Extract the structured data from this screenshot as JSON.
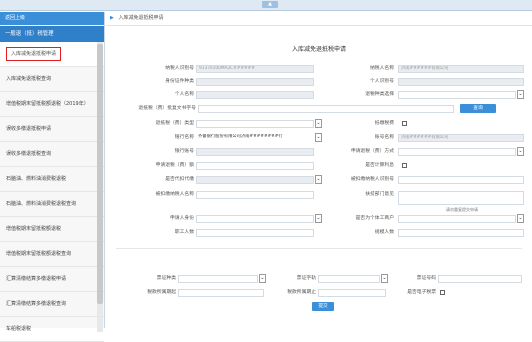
{
  "topbar": {
    "tab_glyph": "▲"
  },
  "sidebar": {
    "header": "返回上级",
    "group": "一般退（抵）税管理",
    "items": [
      "入库减免退抵税申请",
      "入库减免退抵税查询",
      "增值税期末留抵税额退税（2019年）",
      "误收多缴退抵税申请",
      "误收多缴退抵税查询",
      "石脑油、燃料油消费税退税",
      "石脑油、燃料油消费税退税查询",
      "增值税期末留抵税额退税",
      "增值税期末留抵税额退税查询",
      "汇算清缴结算多缴退税申请",
      "汇算清缴结算多缴退税查询",
      "车船税退税"
    ]
  },
  "breadcrumb": {
    "home_icon": "▶",
    "text": "入库减免退抵税申请"
  },
  "form": {
    "title": "入库减免退抵税申请",
    "taxpayer_id_label": "纳税人识别号",
    "taxpayer_id_value": "91370100MA3C######",
    "taxpayer_name_label": "纳税人名称",
    "taxpayer_name_value": "济南######有限公司",
    "idtype_label": "身份证件种类",
    "person_id_label": "个人识别号",
    "person_name_label": "个人名称",
    "refund_type_label": "退税种类选择",
    "refund_type_value": "",
    "doc_no_label": "退抵税（费）批复文书字号",
    "query_button": "查询",
    "apply_type_label": "退抵税（费）类型",
    "offset_label": "抵缴税费",
    "bank_name_label": "银行名称",
    "bank_name_value": "齐鲁银行股份有限公司济南########行",
    "account_label": "账号名称",
    "account_value": "济南######有限公司",
    "bank_acct_label": "银行账号",
    "refund_method_label": "申请退税（费）方式",
    "bank_acct_value": "",
    "refund_method_value": "",
    "apply_amount_label": "申请退税（费）额",
    "interest_label": "是否计算利息",
    "sole_label": "是否代扣代缴",
    "withheld_id_label": "被扣缴纳税人识别号",
    "withheld_name_label": "被扣缴纳税人名称",
    "consent_label": "扶贫部门意见",
    "consent_note": "请勿重复提交申请",
    "applicant_label": "申请人身份",
    "staff_label": "职工人数",
    "sector_label": "是否为个体工商户",
    "scale_label": "规模人数",
    "rows2": {
      "a_label": "票证种类",
      "b_label": "票证字轨",
      "c_label": "票证号码",
      "d_label": "税款所属期起",
      "e_label": "税款所属期止",
      "f_label": "是否电子税票"
    },
    "submit_button": "提交"
  }
}
